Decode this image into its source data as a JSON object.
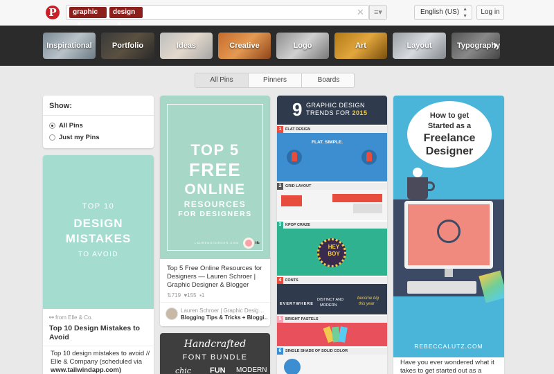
{
  "header": {
    "logo": "P",
    "chips": [
      {
        "label": "graphic",
        "remove": "×"
      },
      {
        "label": "design",
        "remove": "×"
      }
    ],
    "clear": "✕",
    "menu": "≡▾",
    "language": "English (US)",
    "language_arrows": "▲▼",
    "login": "Log in"
  },
  "categories": {
    "items": [
      "Inspirational",
      "Portfolio",
      "Ideas",
      "Creative",
      "Logo",
      "Art",
      "Layout",
      "Typography"
    ],
    "next": "›"
  },
  "tabs": [
    "All Pins",
    "Pinners",
    "Boards"
  ],
  "show_panel": {
    "title": "Show:",
    "options": [
      "All Pins",
      "Just my Pins"
    ],
    "selected": "All Pins"
  },
  "pins": {
    "p1": {
      "image_text": {
        "line1": "TOP 10",
        "line2": "DESIGN",
        "line3": "MISTAKES",
        "line4": "TO AVOID"
      },
      "source": "from Elle & Co.",
      "title": "Top 10 Design Mistakes to Avoid",
      "description": "Top 10 design mistakes to avoid // Elle & Company (scheduled via",
      "link": "www.tailwindapp.com)"
    },
    "p2": {
      "image_text": {
        "line1": "TOP 5",
        "line2": "FREE",
        "line3": "ONLINE",
        "line4": "RESOURCES",
        "line5": "FOR DESIGNERS",
        "credit": "LAURENSCHROER.COM"
      },
      "description": "Top 5 Free Online Resources for Designers — Lauren Schroer | Graphic Designer & Blogger",
      "repins": "719",
      "likes": "155",
      "comments": "1",
      "pinner": "Lauren Schroer | Graphic Desig…",
      "board": "Blogging Tips & Tricks + Bloggi…"
    },
    "p2b": {
      "image_text": {
        "line1": "Handcrafted",
        "line2": "FONT BUNDLE",
        "line3a": "chic",
        "line3b": "FUN",
        "line3c": "MODERN"
      }
    },
    "p3": {
      "header_num": "9",
      "header_line1": "GRAPHIC DESIGN",
      "header_line2": "TRENDS FOR",
      "header_year": "2015",
      "sections": [
        {
          "num": "1",
          "name": "FLAT DESIGN"
        },
        {
          "num": "2",
          "name": "GRID LAYOUT"
        },
        {
          "num": "3",
          "name": "KPOP CRAZE"
        },
        {
          "num": "4",
          "name": "FONTS"
        },
        {
          "num": "5",
          "name": "BRIGHT PASTELS"
        },
        {
          "num": "6",
          "name": "SINGLE SHADE OF SOLID COLOR"
        }
      ],
      "flat_text": "FLAT. SIMPLE.",
      "badge_line1": "HEY",
      "badge_line2": "BOY",
      "fonts_a": "EVERYWHERE",
      "fonts_b": "DISTINCT AND",
      "fonts_c": "MODERN",
      "fonts_d": "become big",
      "fonts_e": "this year"
    },
    "p4": {
      "image_text": {
        "line1": "How to get",
        "line2": "Started as a",
        "line3": "Freelance",
        "line4": "Designer"
      },
      "url_text": "REBECCALUTZ.COM",
      "description": "Have you ever wondered what it takes to get started out as a"
    }
  },
  "colors": {
    "brand": "#cb2027",
    "chip": "#8c1f1c",
    "mint": "#a4ddd0",
    "freelance_blue": "#4bb5d9"
  }
}
